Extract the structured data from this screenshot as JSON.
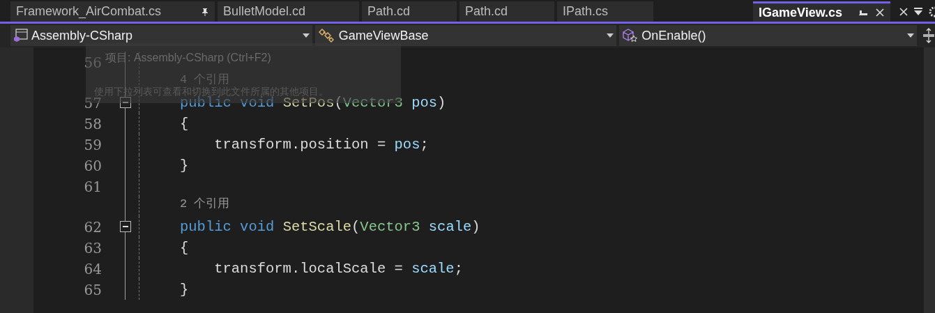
{
  "tabs": [
    {
      "label": "Framework_AirCombat.cs",
      "pinned": true,
      "selected": false
    },
    {
      "label": "BulletModel.cd",
      "pinned": false,
      "selected": false
    },
    {
      "label": "Path.cd",
      "pinned": false,
      "selected": false
    },
    {
      "label": "Path.cd",
      "pinned": false,
      "selected": false
    },
    {
      "label": "IPath.cs",
      "pinned": false,
      "selected": false
    },
    {
      "label": "IGameView.cs",
      "pinned": false,
      "selected": true
    }
  ],
  "navigation": [
    {
      "kind": "project",
      "label": "Assembly-CSharp"
    },
    {
      "kind": "class",
      "label": "GameViewBase"
    },
    {
      "kind": "member",
      "label": "OnEnable()"
    }
  ],
  "tooltip": {
    "title": "项目: Assembly-CSharp (Ctrl+F2)",
    "description": "使用下拉列表可查看和切换到此文件所属的其他项目。"
  },
  "lines": [
    {
      "kind": "code",
      "number": "56",
      "fold": false
    },
    {
      "kind": "codelens",
      "tokens": [
        {
          "text": "4 个引用",
          "kind": "lens"
        }
      ]
    },
    {
      "kind": "code",
      "number": "57",
      "fold": true,
      "tokens": [
        {
          "text": "public",
          "kind": "keyword"
        },
        {
          "text": " void",
          "kind": "keyword"
        },
        {
          "text": " SetPos",
          "kind": "method"
        },
        {
          "text": "(",
          "kind": "plain"
        },
        {
          "text": "Vector3",
          "kind": "type"
        },
        {
          "text": " pos",
          "kind": "param"
        },
        {
          "text": ")",
          "kind": "plain"
        }
      ]
    },
    {
      "kind": "code",
      "number": "58",
      "fold": false,
      "tokens": [
        {
          "text": "{",
          "kind": "plain"
        }
      ]
    },
    {
      "kind": "code",
      "number": "59",
      "fold": false,
      "tokens": [
        {
          "text": "    transform.position = ",
          "kind": "plain"
        },
        {
          "text": "pos",
          "kind": "param"
        },
        {
          "text": ";",
          "kind": "plain"
        }
      ]
    },
    {
      "kind": "code",
      "number": "60",
      "fold": false,
      "tokens": [
        {
          "text": "}",
          "kind": "plain"
        }
      ]
    },
    {
      "kind": "code",
      "number": "61",
      "fold": false
    },
    {
      "kind": "codelens",
      "tokens": [
        {
          "text": "2 个引用",
          "kind": "lens"
        }
      ]
    },
    {
      "kind": "code",
      "number": "62",
      "fold": true,
      "tokens": [
        {
          "text": "public",
          "kind": "keyword"
        },
        {
          "text": " void",
          "kind": "keyword"
        },
        {
          "text": " SetScale",
          "kind": "method"
        },
        {
          "text": "(",
          "kind": "plain"
        },
        {
          "text": "Vector3",
          "kind": "type"
        },
        {
          "text": " scale",
          "kind": "param"
        },
        {
          "text": ")",
          "kind": "plain"
        }
      ]
    },
    {
      "kind": "code",
      "number": "63",
      "fold": false,
      "tokens": [
        {
          "text": "{",
          "kind": "plain"
        }
      ]
    },
    {
      "kind": "code",
      "number": "64",
      "fold": false,
      "tokens": [
        {
          "text": "    transform.localScale = ",
          "kind": "plain"
        },
        {
          "text": "scale",
          "kind": "param"
        },
        {
          "text": ";",
          "kind": "plain"
        }
      ]
    },
    {
      "kind": "code",
      "number": "65",
      "fold": false,
      "tokens": [
        {
          "text": "}",
          "kind": "plain"
        }
      ]
    }
  ]
}
